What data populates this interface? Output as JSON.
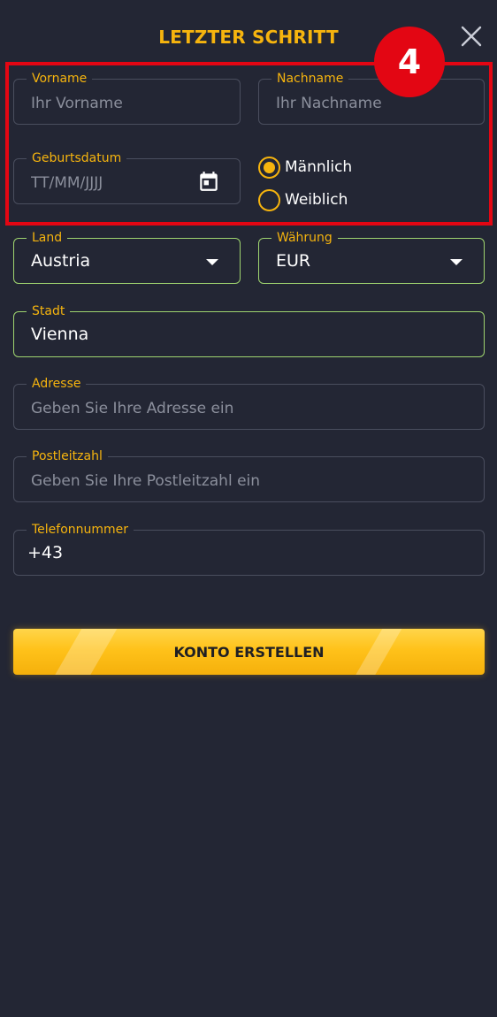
{
  "header": {
    "title": "LETZTER SCHRITT",
    "step_number": "4"
  },
  "form": {
    "first_name": {
      "label": "Vorname",
      "placeholder": "Ihr Vorname"
    },
    "last_name": {
      "label": "Nachname",
      "placeholder": "Ihr Nachname"
    },
    "birthdate": {
      "label": "Geburtsdatum",
      "placeholder": "TT/MM/JJJJ"
    },
    "gender": {
      "options": [
        {
          "label": "Männlich",
          "selected": true
        },
        {
          "label": "Weiblich",
          "selected": false
        }
      ]
    },
    "country": {
      "label": "Land",
      "value": "Austria"
    },
    "currency": {
      "label": "Währung",
      "value": "EUR"
    },
    "city": {
      "label": "Stadt",
      "value": "Vienna"
    },
    "address": {
      "label": "Adresse",
      "placeholder": "Geben Sie Ihre Adresse ein"
    },
    "postal_code": {
      "label": "Postleitzahl",
      "placeholder": "Geben Sie Ihre Postleitzahl ein"
    },
    "phone": {
      "label": "Telefonnummer",
      "value": "+43"
    },
    "submit_label": "KONTO ERSTELLEN"
  },
  "colors": {
    "background": "#232634",
    "accent": "#f6b40e",
    "valid_border": "#9fd46f",
    "highlight": "#e30613"
  },
  "icons": {
    "close": "close-icon",
    "calendar": "calendar-icon",
    "dropdown": "chevron-down-icon"
  }
}
